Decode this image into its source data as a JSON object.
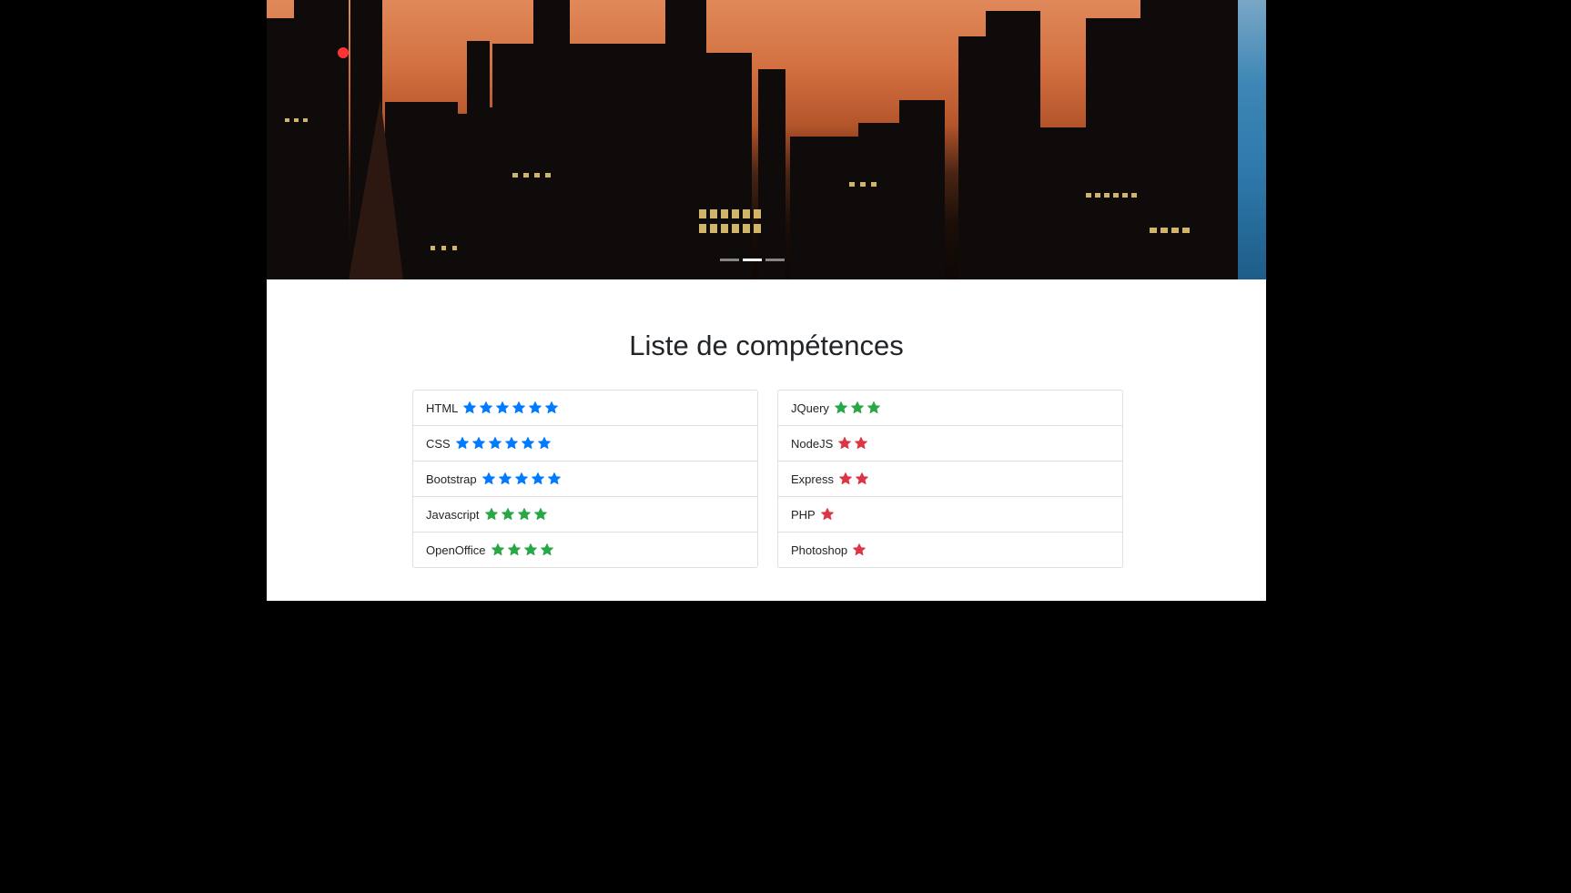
{
  "carousel": {
    "indicators": [
      {
        "active": false
      },
      {
        "active": true
      },
      {
        "active": false
      }
    ]
  },
  "skills": {
    "title": "Liste de compétences",
    "colors": {
      "blue": "#007bff",
      "green": "#28a745",
      "red": "#dc3545"
    },
    "left": [
      {
        "name": "HTML",
        "stars": 6,
        "color": "blue"
      },
      {
        "name": "CSS",
        "stars": 6,
        "color": "blue"
      },
      {
        "name": "Bootstrap",
        "stars": 5,
        "color": "blue"
      },
      {
        "name": "Javascript",
        "stars": 4,
        "color": "green"
      },
      {
        "name": "OpenOffice",
        "stars": 4,
        "color": "green"
      }
    ],
    "right": [
      {
        "name": "JQuery",
        "stars": 3,
        "color": "green"
      },
      {
        "name": "NodeJS",
        "stars": 2,
        "color": "red"
      },
      {
        "name": "Express",
        "stars": 2,
        "color": "red"
      },
      {
        "name": "PHP",
        "stars": 1,
        "color": "red"
      },
      {
        "name": "Photoshop",
        "stars": 1,
        "color": "red"
      }
    ]
  }
}
